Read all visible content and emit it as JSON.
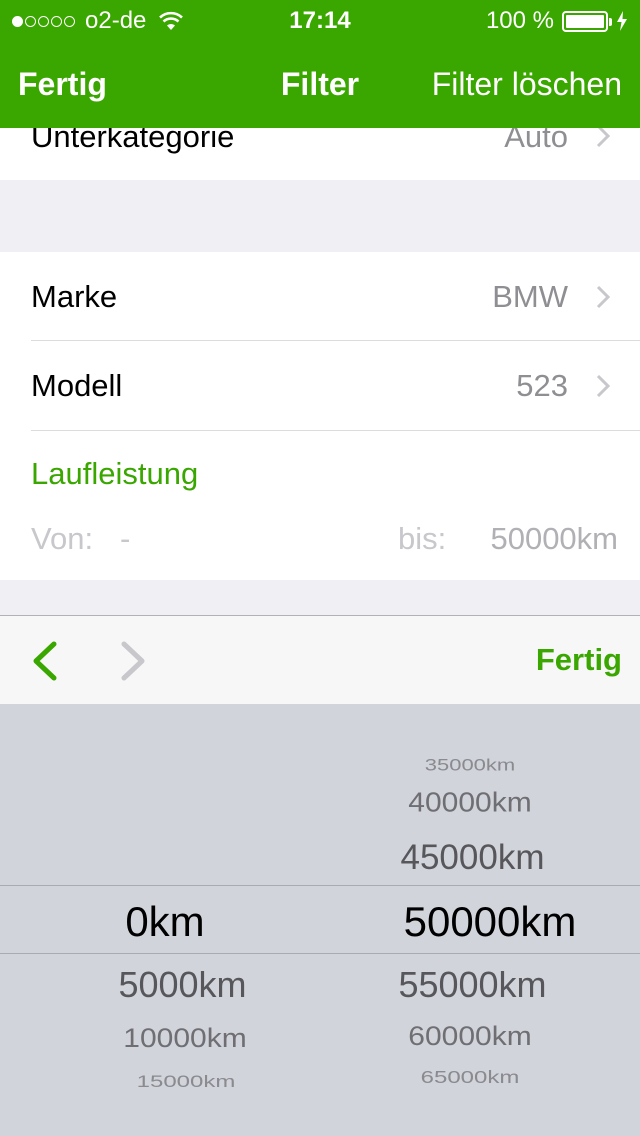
{
  "status_bar": {
    "carrier": "o2-de",
    "time": "17:14",
    "battery": "100 %",
    "signal_bars_filled": 1,
    "signal_bars_total": 5
  },
  "nav": {
    "left_button": "Fertig",
    "title": "Filter",
    "right_button": "Filter löschen"
  },
  "rows": {
    "subcategory": {
      "label": "Unterkategorie",
      "value": "Auto"
    },
    "brand": {
      "label": "Marke",
      "value": "BMW"
    },
    "model": {
      "label": "Modell",
      "value": "523"
    }
  },
  "mileage": {
    "title": "Laufleistung",
    "from_label": "Von:",
    "from_value": "-",
    "to_label": "bis:",
    "to_value": "50000km"
  },
  "toolbar": {
    "done_label": "Fertig"
  },
  "picker": {
    "left_column": {
      "selected": "0km",
      "below": [
        "5000km",
        "10000km",
        "15000km"
      ]
    },
    "right_column": {
      "above": [
        "35000km",
        "40000km",
        "45000km"
      ],
      "selected": "50000km",
      "below": [
        "55000km",
        "60000km",
        "65000km"
      ]
    }
  },
  "colors": {
    "accent": "#3aa600",
    "background": "#efeff4",
    "picker_background": "#d1d4db",
    "secondary_text": "#8e8e93"
  }
}
